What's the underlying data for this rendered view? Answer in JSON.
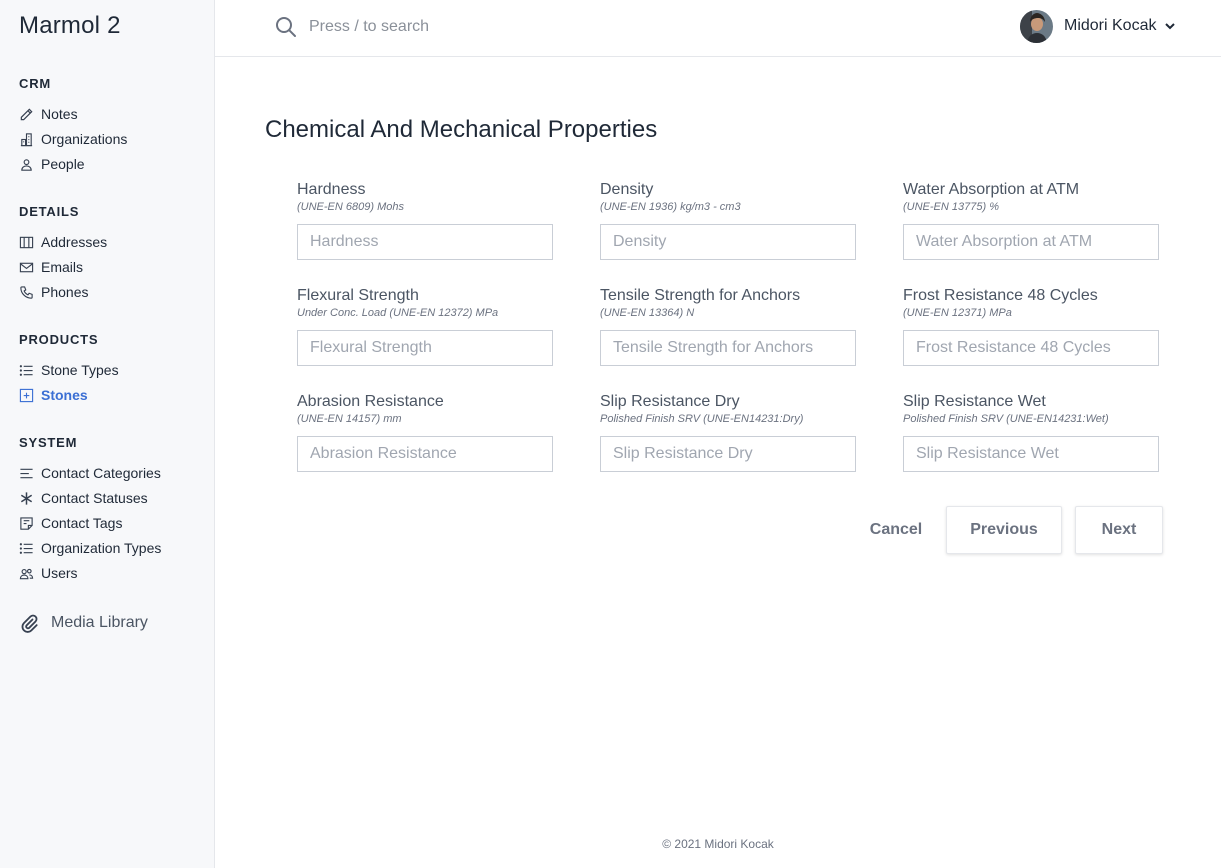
{
  "app": {
    "title": "Marmol 2"
  },
  "sidebar": {
    "sections": [
      {
        "title": "CRM",
        "items": [
          {
            "label": "Notes",
            "icon": "pencil-icon"
          },
          {
            "label": "Organizations",
            "icon": "office-building-icon"
          },
          {
            "label": "People",
            "icon": "user-icon"
          }
        ]
      },
      {
        "title": "DETAILS",
        "items": [
          {
            "label": "Addresses",
            "icon": "map-icon"
          },
          {
            "label": "Emails",
            "icon": "mail-icon"
          },
          {
            "label": "Phones",
            "icon": "phone-icon"
          }
        ]
      },
      {
        "title": "PRODUCTS",
        "items": [
          {
            "label": "Stone Types",
            "icon": "list-icon"
          },
          {
            "label": "Stones",
            "icon": "plus-square-icon",
            "active": true
          }
        ]
      },
      {
        "title": "SYSTEM",
        "items": [
          {
            "label": "Contact Categories",
            "icon": "menu-alt-icon"
          },
          {
            "label": "Contact Statuses",
            "icon": "asterisk-icon"
          },
          {
            "label": "Contact Tags",
            "icon": "tag-note-icon"
          },
          {
            "label": "Organization Types",
            "icon": "list-icon"
          },
          {
            "label": "Users",
            "icon": "users-icon"
          }
        ]
      }
    ],
    "media_library": {
      "label": "Media Library",
      "icon": "paperclip-icon"
    },
    "active_color": "#3b6fd4"
  },
  "header": {
    "search_placeholder": "Press / to search",
    "user_name": "Midori Kocak"
  },
  "main": {
    "title": "Chemical And Mechanical Properties",
    "fields": [
      {
        "label": "Hardness",
        "hint": "(UNE-EN 6809) Mohs",
        "placeholder": "Hardness",
        "value": ""
      },
      {
        "label": "Density",
        "hint": "(UNE-EN 1936) kg/m3 - cm3",
        "placeholder": "Density",
        "value": ""
      },
      {
        "label": "Water Absorption at ATM",
        "hint": "(UNE-EN 13775) %",
        "placeholder": "Water Absorption at ATM",
        "value": ""
      },
      {
        "label": "Flexural Strength",
        "hint": "Under Conc. Load (UNE-EN 12372) MPa",
        "placeholder": "Flexural Strength",
        "value": ""
      },
      {
        "label": "Tensile Strength for Anchors",
        "hint": "(UNE-EN 13364) N",
        "placeholder": "Tensile Strength for Anchors",
        "value": ""
      },
      {
        "label": "Frost Resistance 48 Cycles",
        "hint": "(UNE-EN 12371) MPa",
        "placeholder": "Frost Resistance 48 Cycles",
        "value": ""
      },
      {
        "label": "Abrasion Resistance",
        "hint": "(UNE-EN 14157) mm",
        "placeholder": "Abrasion Resistance",
        "value": ""
      },
      {
        "label": "Slip Resistance Dry",
        "hint": "Polished Finish SRV (UNE-EN14231:Dry)",
        "placeholder": "Slip Resistance Dry",
        "value": ""
      },
      {
        "label": "Slip Resistance Wet",
        "hint": "Polished Finish SRV (UNE-EN14231:Wet)",
        "placeholder": "Slip Resistance Wet",
        "value": ""
      }
    ],
    "buttons": {
      "cancel": "Cancel",
      "previous": "Previous",
      "next": "Next"
    }
  },
  "footer": {
    "text": "© 2021 Midori Kocak"
  }
}
